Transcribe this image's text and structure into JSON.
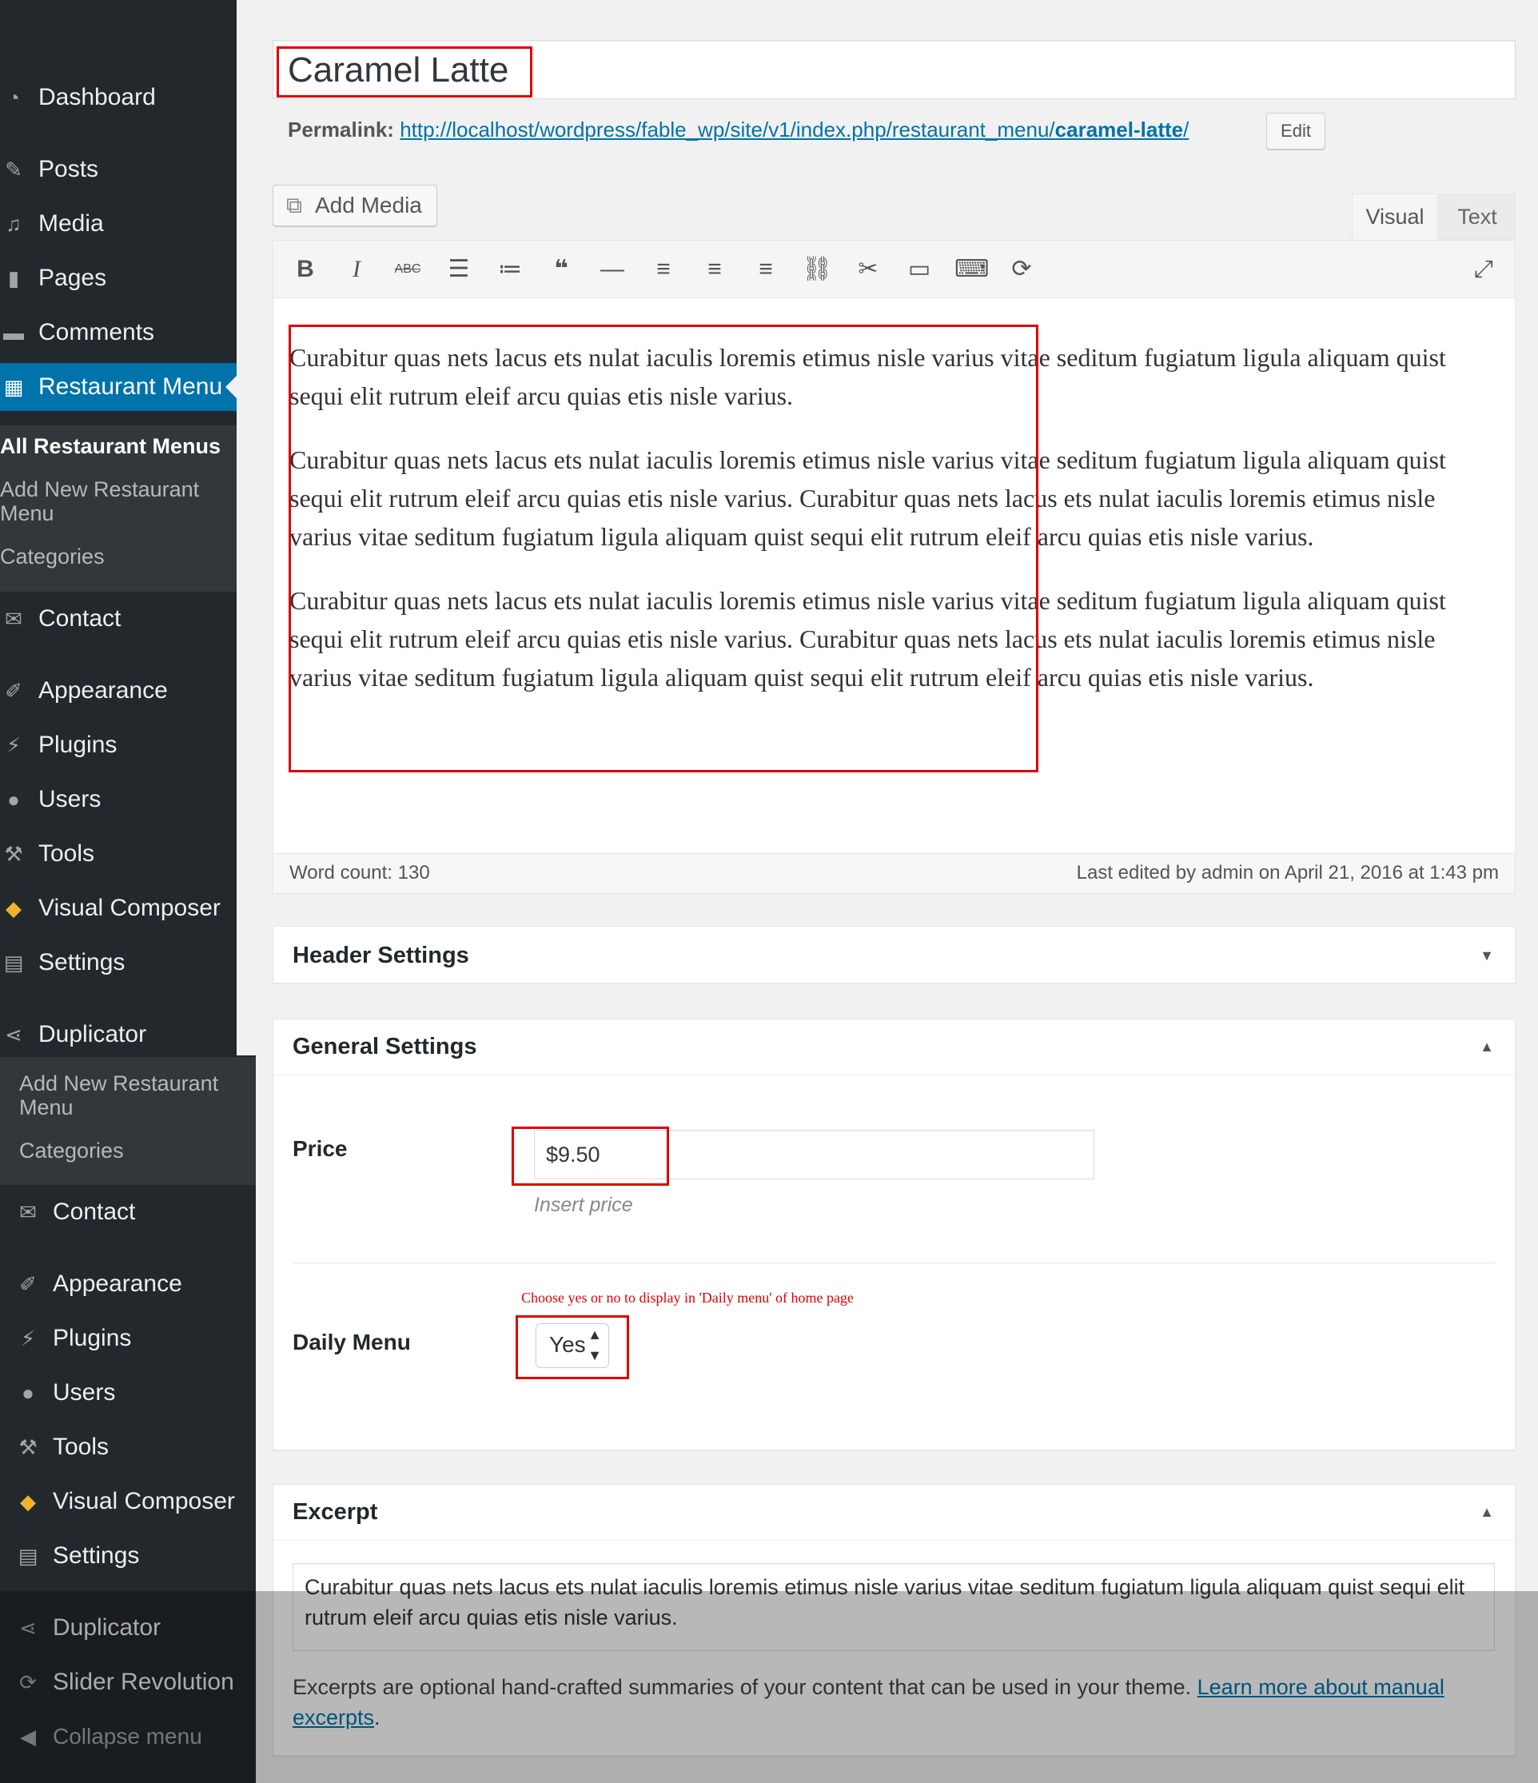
{
  "sidebar": {
    "items": [
      {
        "label": "Dashboard",
        "icon": "dashboard-icon"
      },
      {
        "label": "Posts",
        "icon": "pin-icon"
      },
      {
        "label": "Media",
        "icon": "media-icon"
      },
      {
        "label": "Pages",
        "icon": "pages-icon"
      },
      {
        "label": "Comments",
        "icon": "comment-icon"
      },
      {
        "label": "Restaurant Menu",
        "icon": "calendar-icon",
        "active": true
      },
      {
        "label": "Contact",
        "icon": "mail-icon"
      },
      {
        "label": "Appearance",
        "icon": "brush-icon"
      },
      {
        "label": "Plugins",
        "icon": "plug-icon"
      },
      {
        "label": "Users",
        "icon": "user-icon"
      },
      {
        "label": "Tools",
        "icon": "wrench-icon"
      },
      {
        "label": "Visual Composer",
        "icon": "vc-icon"
      },
      {
        "label": "Settings",
        "icon": "sliders-icon"
      },
      {
        "label": "Duplicator",
        "icon": "share-icon"
      }
    ],
    "submenu": [
      "All Restaurant Menus",
      "Add New Restaurant Menu",
      "Categories"
    ],
    "submenu_dup": [
      "Add New Restaurant Menu",
      "Categories"
    ],
    "items_dup": [
      {
        "label": "Contact"
      },
      {
        "label": "Appearance"
      },
      {
        "label": "Plugins"
      },
      {
        "label": "Users"
      },
      {
        "label": "Tools"
      },
      {
        "label": "Visual Composer"
      },
      {
        "label": "Settings"
      },
      {
        "label": "Duplicator"
      },
      {
        "label": "Slider Revolution"
      }
    ],
    "collapse": "Collapse menu"
  },
  "post": {
    "title": "Caramel Latte",
    "permalink_label": "Permalink:",
    "permalink_base": "http://localhost/wordpress/fable_wp/site/v1/index.php/restaurant_menu/",
    "permalink_slug": "caramel-latte",
    "permalink_end": "/",
    "edit_label": "Edit"
  },
  "editor": {
    "add_media": "Add Media",
    "tabs": [
      "Visual",
      "Text"
    ],
    "paragraphs": [
      "Curabitur quas nets lacus ets nulat iaculis loremis etimus nisle varius vitae seditum fugiatum ligula aliquam quist sequi elit rutrum eleif arcu quias etis nisle varius.",
      "Curabitur quas nets lacus ets nulat iaculis loremis etimus nisle varius vitae seditum fugiatum ligula aliquam quist sequi elit rutrum eleif arcu quias etis nisle varius. Curabitur quas nets lacus ets nulat iaculis loremis etimus nisle varius vitae seditum fugiatum ligula aliquam quist sequi elit rutrum eleif arcu quias etis nisle varius.",
      "Curabitur quas nets lacus ets nulat iaculis loremis etimus nisle varius vitae seditum fugiatum ligula aliquam quist sequi elit rutrum eleif arcu quias etis nisle varius. Curabitur quas nets lacus ets nulat iaculis loremis etimus nisle varius vitae seditum fugiatum ligula aliquam quist sequi elit rutrum eleif arcu quias etis nisle varius."
    ],
    "word_count": "Word count: 130",
    "last_edited": "Last edited by admin on April 21, 2016 at 1:43 pm"
  },
  "header_settings": {
    "title": "Header Settings"
  },
  "general_settings": {
    "title": "General Settings",
    "price_label": "Price",
    "price_value": "$9.50",
    "price_hint": "Insert price",
    "daily_note": "Choose yes or no to display in 'Daily menu' of home page",
    "daily_label": "Daily Menu",
    "daily_value": "Yes"
  },
  "excerpt": {
    "title": "Excerpt",
    "text": "Curabitur quas nets lacus ets nulat iaculis loremis etimus nisle varius vitae seditum fugiatum ligula aliquam quist sequi elit rutrum eleif arcu quias etis nisle varius.",
    "help": "Excerpts are optional hand-crafted summaries of your content that can be used in your theme.",
    "help_link": "Learn more about manual excerpts",
    "help_end": "."
  },
  "colors": {
    "accent": "#0073aa",
    "sidebar": "#23282d",
    "highlight": "#e00000"
  }
}
